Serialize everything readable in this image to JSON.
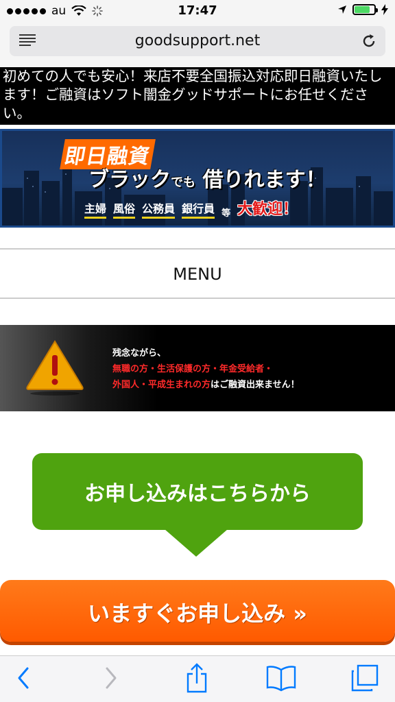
{
  "status_bar": {
    "carrier": "au",
    "time": "17:47",
    "battery_level": 0.8,
    "signal_bars": 5
  },
  "address_bar": {
    "url": "goodsupport.net"
  },
  "page": {
    "intro_text": "初めての人でも安心！来店不要全国振込対応即日融資いたします！ご融資はソフト闇金グッドサポートにお任せください。",
    "banner": {
      "line1": "即日融資",
      "line2_main": "ブラック",
      "line2_small": "でも",
      "line2_end": "借りれます！",
      "tags": [
        "主婦",
        "風俗",
        "公務員",
        "銀行員"
      ],
      "tags_suffix": "等",
      "welcome": "大歓迎！"
    },
    "menu_label": "MENU",
    "warning": {
      "line1": "残念ながら、",
      "line2_red": "無職の方・生活保護の方・年金受給者・",
      "line3_red": "外国人・平成生まれの方",
      "line3_white": "はご融資出来ません！"
    },
    "apply_here_label": "お申し込みはこちらから",
    "apply_now_label": "いますぐお申し込み »"
  },
  "colors": {
    "accent_green": "#4fa30f",
    "accent_orange": "#ff6a00",
    "warning_red": "#ff2a2a",
    "ios_blue": "#007aff"
  },
  "toolbar": {
    "icons": [
      "back-icon",
      "forward-icon",
      "share-icon",
      "bookmarks-icon",
      "tabs-icon"
    ]
  }
}
